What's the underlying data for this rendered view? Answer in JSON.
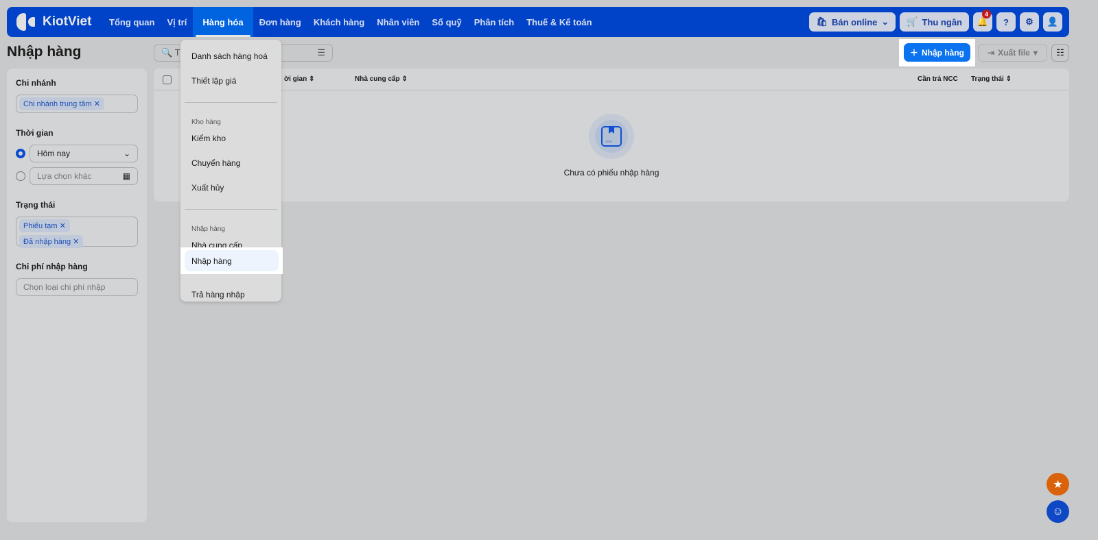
{
  "header": {
    "brand": "KiotViet",
    "nav": [
      "Tổng quan",
      "Vị trí",
      "Hàng hóa",
      "Đơn hàng",
      "Khách hàng",
      "Nhân viên",
      "Sổ quỹ",
      "Phân tích",
      "Thuế & Kế toán"
    ],
    "ban_online": "Bán online",
    "thu_ngan": "Thu ngân",
    "notif_count": "4"
  },
  "page": {
    "title": "Nhập hàng",
    "search_placeholder": "T",
    "add_button": "Nhập hàng",
    "export_button": "Xuất file"
  },
  "filters": {
    "branch_label": "Chi nhánh",
    "branch_tags": [
      "Chi nhánh trung tâm"
    ],
    "time_label": "Thời gian",
    "time_today": "Hôm nay",
    "time_other": "Lựa chọn khác",
    "status_label": "Trạng thái",
    "status_tags": [
      "Phiếu tạm",
      "Đã nhập hàng"
    ],
    "cost_label": "Chi phí nhập hàng",
    "cost_placeholder": "Chọn loại chi phí nhập"
  },
  "table": {
    "columns": [
      "ời gian",
      "Nhà cung cấp",
      "Cần trả NCC",
      "Trạng thái"
    ],
    "empty": "Chưa có phiếu nhập hàng"
  },
  "menu": {
    "items": [
      "Danh sách hàng hoá",
      "Thiết lập giá"
    ],
    "group1": "Kho hàng",
    "group1_items": [
      "Kiểm kho",
      "Chuyển hàng",
      "Xuất hủy"
    ],
    "group2": "Nhập hàng",
    "group2_items": [
      "Nhà cung cấp",
      "Nhập hàng",
      "Trả hàng nhập"
    ]
  }
}
